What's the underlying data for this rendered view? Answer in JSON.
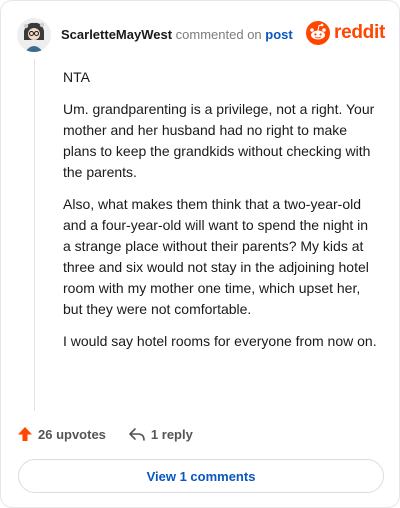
{
  "header": {
    "username": "ScarletteMayWest",
    "action_text": "commented on",
    "post_link": "post",
    "brand": "reddit"
  },
  "comment": {
    "paragraphs": [
      "NTA",
      "Um. grandparenting is a privilege, not a right. Your mother and her husband had no right to make plans to keep the grandkids without checking with the parents.",
      "Also, what makes them think that a two-year-old and a four-year-old will want to spend the night in a strange place without their parents? My kids at three and six would not stay in the adjoining hotel room with my mother one time, which upset her, but they were not comfortable.",
      "I would say hotel rooms for everyone from now on."
    ]
  },
  "actions": {
    "upvotes": "26 upvotes",
    "replies": "1 reply"
  },
  "view_comments_label": "View 1 comments",
  "colors": {
    "brand": "#ff4500",
    "link": "#0a56c2"
  },
  "icons": [
    "avatar-icon",
    "reddit-logo-icon",
    "upvote-arrow-icon",
    "reply-icon"
  ]
}
